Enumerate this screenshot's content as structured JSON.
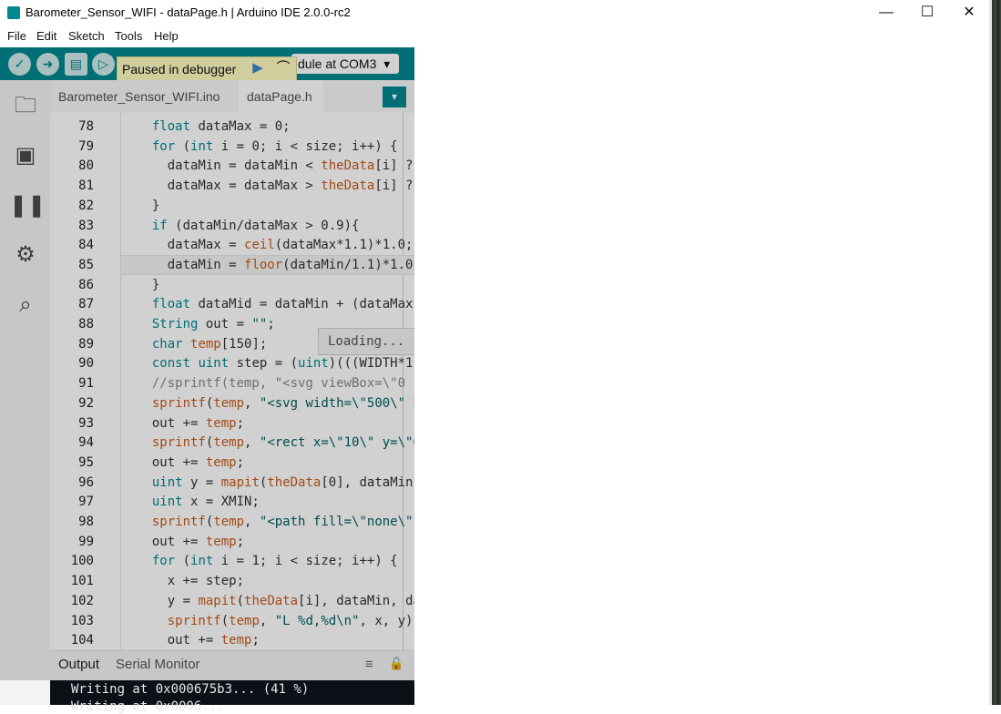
{
  "window": {
    "title": "Barometer_Sensor_WIFI - dataPage.h | Arduino IDE 2.0.0-rc2",
    "app_icon": "arduino-infinity-icon",
    "minimize_glyph": "—",
    "maximize_glyph": "☐",
    "close_glyph": "✕"
  },
  "menu": [
    "File",
    "Edit",
    "Sketch",
    "Tools",
    "Help"
  ],
  "toolbar": {
    "verify_glyph": "✓",
    "upload_glyph": "➜",
    "new_glyph": "▤",
    "debug_glyph": "▷",
    "board": "dule at COM3",
    "board_arrow": "▾",
    "tooltip": "Paused in debugger",
    "continue_glyph": "▶",
    "stepover_glyph": "⌒"
  },
  "colors": {
    "accent": "#00878f",
    "keyword": "#00878f",
    "function": "#c75b1b"
  },
  "sidebar": [
    "folder-icon",
    "board-icon",
    "library-icon",
    "debug-icon",
    "search-icon"
  ],
  "sidebar_glyphs": [
    "🗀",
    "▣",
    "❚❚",
    "⚙",
    "⌕"
  ],
  "tabs": [
    "Barometer_Sensor_WIFI.ino",
    "dataPage.h"
  ],
  "tab_menu": "▾",
  "editor": {
    "lines": [
      {
        "n": "78",
        "t": "  float dataMax = 0;"
      },
      {
        "n": "79",
        "t": "  for (int i = 0; i < size; i++) {"
      },
      {
        "n": "80",
        "t": "    dataMin = dataMin < theData[i] ?"
      },
      {
        "n": "81",
        "t": "    dataMax = dataMax > theData[i] ?"
      },
      {
        "n": "82",
        "t": "  }"
      },
      {
        "n": "83",
        "t": "  if (dataMin/dataMax > 0.9){"
      },
      {
        "n": "84",
        "t": "    dataMax = ceil(dataMax*1.1)*1.0;"
      },
      {
        "n": "85",
        "t": "    dataMin = floor(dataMin/1.1)*1.0;"
      },
      {
        "n": "86",
        "t": "  }"
      },
      {
        "n": "87",
        "t": "  float dataMid = dataMin + (dataMax"
      },
      {
        "n": "88",
        "t": "  String out = \"\";"
      },
      {
        "n": "89",
        "t": "  char temp[150];"
      },
      {
        "n": "90",
        "t": "  const uint step = (uint)(((WIDTH*1."
      },
      {
        "n": "91",
        "t": "  //sprintf(temp, \"<svg viewBox=\\\"0"
      },
      {
        "n": "92",
        "t": "  sprintf(temp, \"<svg width=\\\"500\\\" h"
      },
      {
        "n": "93",
        "t": "  out += temp;"
      },
      {
        "n": "94",
        "t": "  sprintf(temp, \"<rect x=\\\"10\\\" y=\\\"0"
      },
      {
        "n": "95",
        "t": "  out += temp;"
      },
      {
        "n": "96",
        "t": "  uint y = mapit(theData[0], dataMin,"
      },
      {
        "n": "97",
        "t": "  uint x = XMIN;"
      },
      {
        "n": "98",
        "t": "  sprintf(temp, \"<path fill=\\\"none\\\""
      },
      {
        "n": "99",
        "t": "  out += temp;"
      },
      {
        "n": "100",
        "t": "  for (int i = 1; i < size; i++) {"
      },
      {
        "n": "101",
        "t": "    x += step;"
      },
      {
        "n": "102",
        "t": "    y = mapit(theData[i], dataMin, da"
      },
      {
        "n": "103",
        "t": "    sprintf(temp, \"L %d,%d\\n\", x, y);"
      },
      {
        "n": "104",
        "t": "    out += temp;"
      }
    ],
    "highlighted_line": "85",
    "loading": "Loading..."
  },
  "output": {
    "tabs": [
      "Output",
      "Serial Monitor"
    ],
    "list_glyph": "≡",
    "lock_glyph": "🔓",
    "line": "Writing at 0x000675b3... (41 %)",
    "line2": "Writing at 0x0006..."
  }
}
